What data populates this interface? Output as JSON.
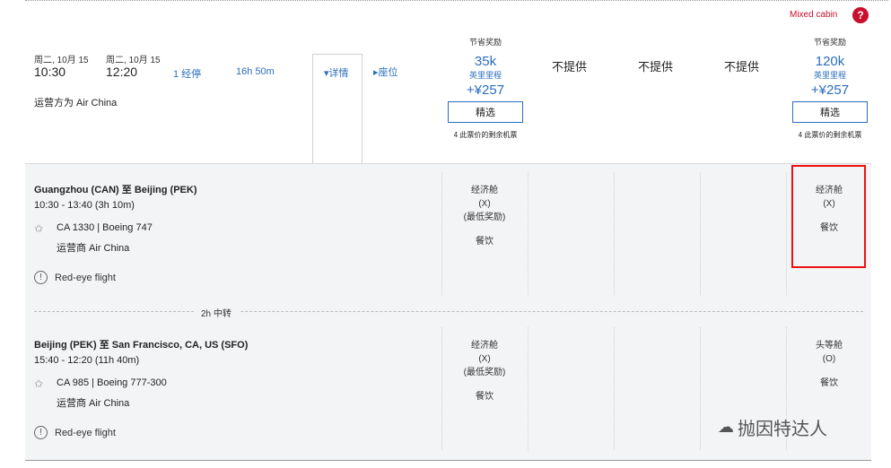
{
  "header": {
    "mixed_cabin": "Mixed cabin",
    "help_icon": "?"
  },
  "flight": {
    "depart_date": "周二, 10月 15",
    "arrive_date": "周二, 10月 15",
    "depart_time": "10:30",
    "arrive_time": "12:20",
    "stops": "1 经停",
    "duration": "16h 50m",
    "operated_by": "运营方为 Air China",
    "details_label": "▾详情",
    "seats_label": "▸座位"
  },
  "fares": [
    {
      "label": "节省奖励",
      "miles": "35k",
      "unit": "英里里程",
      "tax": "+¥257",
      "button": "精选",
      "remaining": "4 此票价的剩余机票"
    },
    {
      "na": "不提供"
    },
    {
      "na": "不提供"
    },
    {
      "na": "不提供"
    },
    {
      "label": "节省奖励",
      "miles": "120k",
      "unit": "英里里程",
      "tax": "+¥257",
      "button": "精选",
      "remaining": "4 此票价的剩余机票"
    }
  ],
  "segments": [
    {
      "route": "Guangzhou (CAN) 至 Beijing (PEK)",
      "time": "10:30 - 13:40 (3h 10m)",
      "flight": "CA 1330 | Boeing 747",
      "operator": "运营商 Air China",
      "redeye": "Red-eye flight",
      "cabin1": {
        "name": "经济舱",
        "code": "(X)",
        "note": "(最低奖励)",
        "meal": "餐饮"
      },
      "cabin5": {
        "name": "经济舱",
        "code": "(X)",
        "meal": "餐饮"
      }
    },
    {
      "route": "Beijing (PEK) 至 San Francisco, CA, US (SFO)",
      "time": "15:40 - 12:20 (11h 40m)",
      "flight": "CA 985 | Boeing 777-300",
      "operator": "运营商 Air China",
      "redeye": "Red-eye flight",
      "cabin1": {
        "name": "经济舱",
        "code": "(X)",
        "note": "(最低奖励)",
        "meal": "餐饮"
      },
      "cabin5": {
        "name": "头等舱",
        "code": "(O)",
        "meal": "餐饮"
      }
    }
  ],
  "connection": "2h 中转",
  "watermark": "抛因特达人",
  "colors": {
    "accent": "#2a6ebd",
    "highlight": "#e11111",
    "mixed_cabin": "#c8102e"
  }
}
